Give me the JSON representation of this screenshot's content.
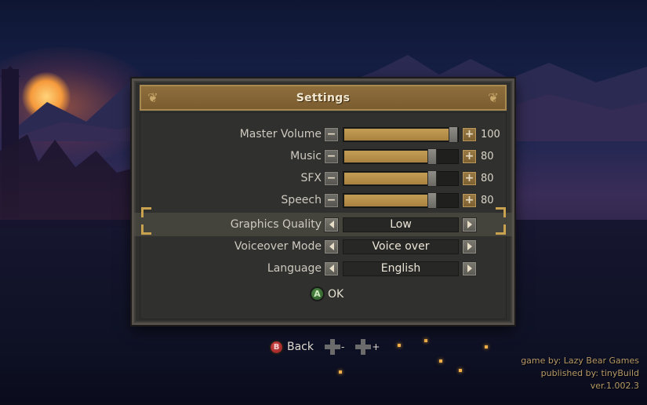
{
  "dialog": {
    "title": "Settings"
  },
  "volume_sliders": [
    {
      "label": "Master Volume",
      "value": 100,
      "value_text": "100"
    },
    {
      "label": "Music",
      "value": 80,
      "value_text": "80"
    },
    {
      "label": "SFX",
      "value": 80,
      "value_text": "80"
    },
    {
      "label": "Speech",
      "value": 80,
      "value_text": "80"
    }
  ],
  "selectors": [
    {
      "label": "Graphics Quality",
      "value": "Low",
      "highlighted": true
    },
    {
      "label": "Voiceover Mode",
      "value": "Voice over",
      "highlighted": false
    },
    {
      "label": "Language",
      "value": "English",
      "highlighted": false
    }
  ],
  "ok": {
    "button_glyph": "A",
    "label": "OK"
  },
  "bottom_controls": {
    "back_glyph": "B",
    "back_label": "Back",
    "minus_sign": "-",
    "plus_sign": "+"
  },
  "credits": {
    "line1": "game by: Lazy Bear Games",
    "line2": "published by: tinyBuild",
    "line3": "ver.1.002.3"
  },
  "icons": {
    "minus": "minus-icon",
    "plus": "plus-icon",
    "left_arrow": "arrow-left-icon",
    "right_arrow": "arrow-right-icon",
    "dpad": "dpad-icon"
  },
  "colors": {
    "header_gold": "#8e6e3c",
    "slider_fill": "#c49d55",
    "selection_bracket": "#c8a24e",
    "ok_green": "#4f8a45",
    "back_red": "#d24545"
  }
}
